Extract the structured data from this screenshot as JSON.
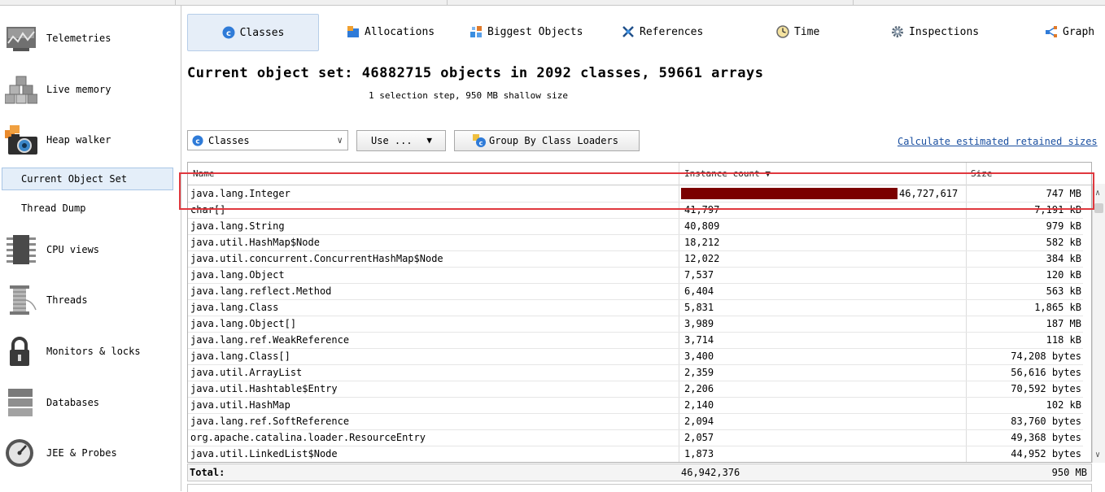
{
  "sidebar": {
    "items": [
      {
        "label": "Telemetries",
        "icon": "telemetries-icon"
      },
      {
        "label": "Live memory",
        "icon": "live-memory-icon"
      },
      {
        "label": "Heap walker",
        "icon": "heap-walker-camera-icon"
      },
      {
        "label": "CPU views",
        "icon": "cpu-chip-icon"
      },
      {
        "label": "Threads",
        "icon": "threads-spool-icon"
      },
      {
        "label": "Monitors & locks",
        "icon": "padlock-icon"
      },
      {
        "label": "Databases",
        "icon": "database-icon"
      },
      {
        "label": "JEE & Probes",
        "icon": "gauge-icon"
      }
    ],
    "subitems": [
      {
        "label": "Current Object Set",
        "selected": true
      },
      {
        "label": "Thread Dump",
        "selected": false
      }
    ]
  },
  "tabs": [
    {
      "label": "Classes",
      "icon": "classes-icon",
      "active": true
    },
    {
      "label": "Allocations",
      "icon": "allocations-icon",
      "active": false
    },
    {
      "label": "Biggest Objects",
      "icon": "biggest-objects-icon",
      "active": false
    },
    {
      "label": "References",
      "icon": "references-icon",
      "active": false
    },
    {
      "label": "Time",
      "icon": "clock-icon",
      "active": false
    },
    {
      "label": "Inspections",
      "icon": "gear-icon",
      "active": false
    },
    {
      "label": "Graph",
      "icon": "graph-icon",
      "active": false
    }
  ],
  "heading": "Current object set: 46882715 objects in 2092 classes, 59661 arrays",
  "subheading": "1 selection step, 950 MB shallow size",
  "toolbar": {
    "view_select": "Classes",
    "use_button": "Use ...",
    "group_button": "Group By Class Loaders",
    "retained_link": "Calculate estimated retained sizes"
  },
  "table": {
    "columns": {
      "name": "Name",
      "count": "Instance count ▼",
      "size": "Size"
    },
    "max_count": 46727617,
    "rows": [
      {
        "name": "java.lang.Integer",
        "count": "46,727,617",
        "count_value": 46727617,
        "size": "747 MB"
      },
      {
        "name": "char[]",
        "count": "41,797",
        "size": "7,191 kB"
      },
      {
        "name": "java.lang.String",
        "count": "40,809",
        "size": "979 kB"
      },
      {
        "name": "java.util.HashMap$Node",
        "count": "18,212",
        "size": "582 kB"
      },
      {
        "name": "java.util.concurrent.ConcurrentHashMap$Node",
        "count": "12,022",
        "size": "384 kB"
      },
      {
        "name": "java.lang.Object",
        "count": "7,537",
        "size": "120 kB"
      },
      {
        "name": "java.lang.reflect.Method",
        "count": "6,404",
        "size": "563 kB"
      },
      {
        "name": "java.lang.Class",
        "count": "5,831",
        "size": "1,865 kB"
      },
      {
        "name": "java.lang.Object[]",
        "count": "3,989",
        "size": "187 MB"
      },
      {
        "name": "java.lang.ref.WeakReference",
        "count": "3,714",
        "size": "118 kB"
      },
      {
        "name": "java.lang.Class[]",
        "count": "3,400",
        "size": "74,208 bytes"
      },
      {
        "name": "java.util.ArrayList",
        "count": "2,359",
        "size": "56,616 bytes"
      },
      {
        "name": "java.util.Hashtable$Entry",
        "count": "2,206",
        "size": "70,592 bytes"
      },
      {
        "name": "java.util.HashMap",
        "count": "2,140",
        "size": "102 kB"
      },
      {
        "name": "java.lang.ref.SoftReference",
        "count": "2,094",
        "size": "83,760 bytes"
      },
      {
        "name": "org.apache.catalina.loader.ResourceEntry",
        "count": "2,057",
        "size": "49,368 bytes"
      },
      {
        "name": "java.util.LinkedList$Node",
        "count": "1,873",
        "size": "44,952 bytes"
      }
    ],
    "total": {
      "label": "Total:",
      "count": "46,942,376",
      "size": "950 MB"
    }
  },
  "colors": {
    "bar": "#7b0000",
    "highlight": "#e0383e",
    "link": "#1a4fa0"
  }
}
